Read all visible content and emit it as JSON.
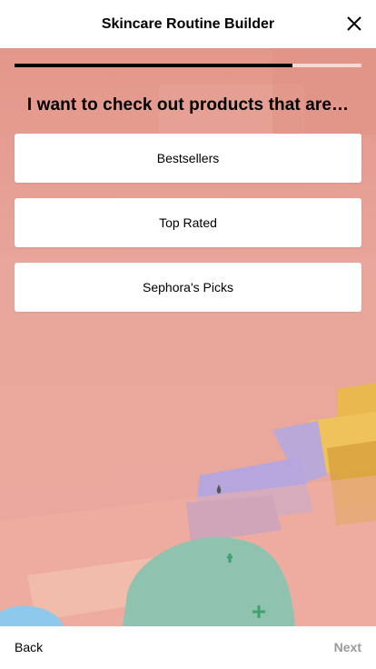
{
  "header": {
    "title": "Skincare Routine Builder",
    "close_icon": "close-icon"
  },
  "progress": {
    "fraction": 0.8
  },
  "question": {
    "text": "I want to check out products that are…"
  },
  "options": [
    {
      "label": "Bestsellers"
    },
    {
      "label": "Top Rated"
    },
    {
      "label": "Sephora's Picks"
    }
  ],
  "footer": {
    "back_label": "Back",
    "next_label": "Next"
  },
  "colors": {
    "background_salmon": "#e9a59a",
    "progress_fill": "#000000",
    "progress_track": "#f4d9d4",
    "next_disabled": "#9a9a9a"
  }
}
